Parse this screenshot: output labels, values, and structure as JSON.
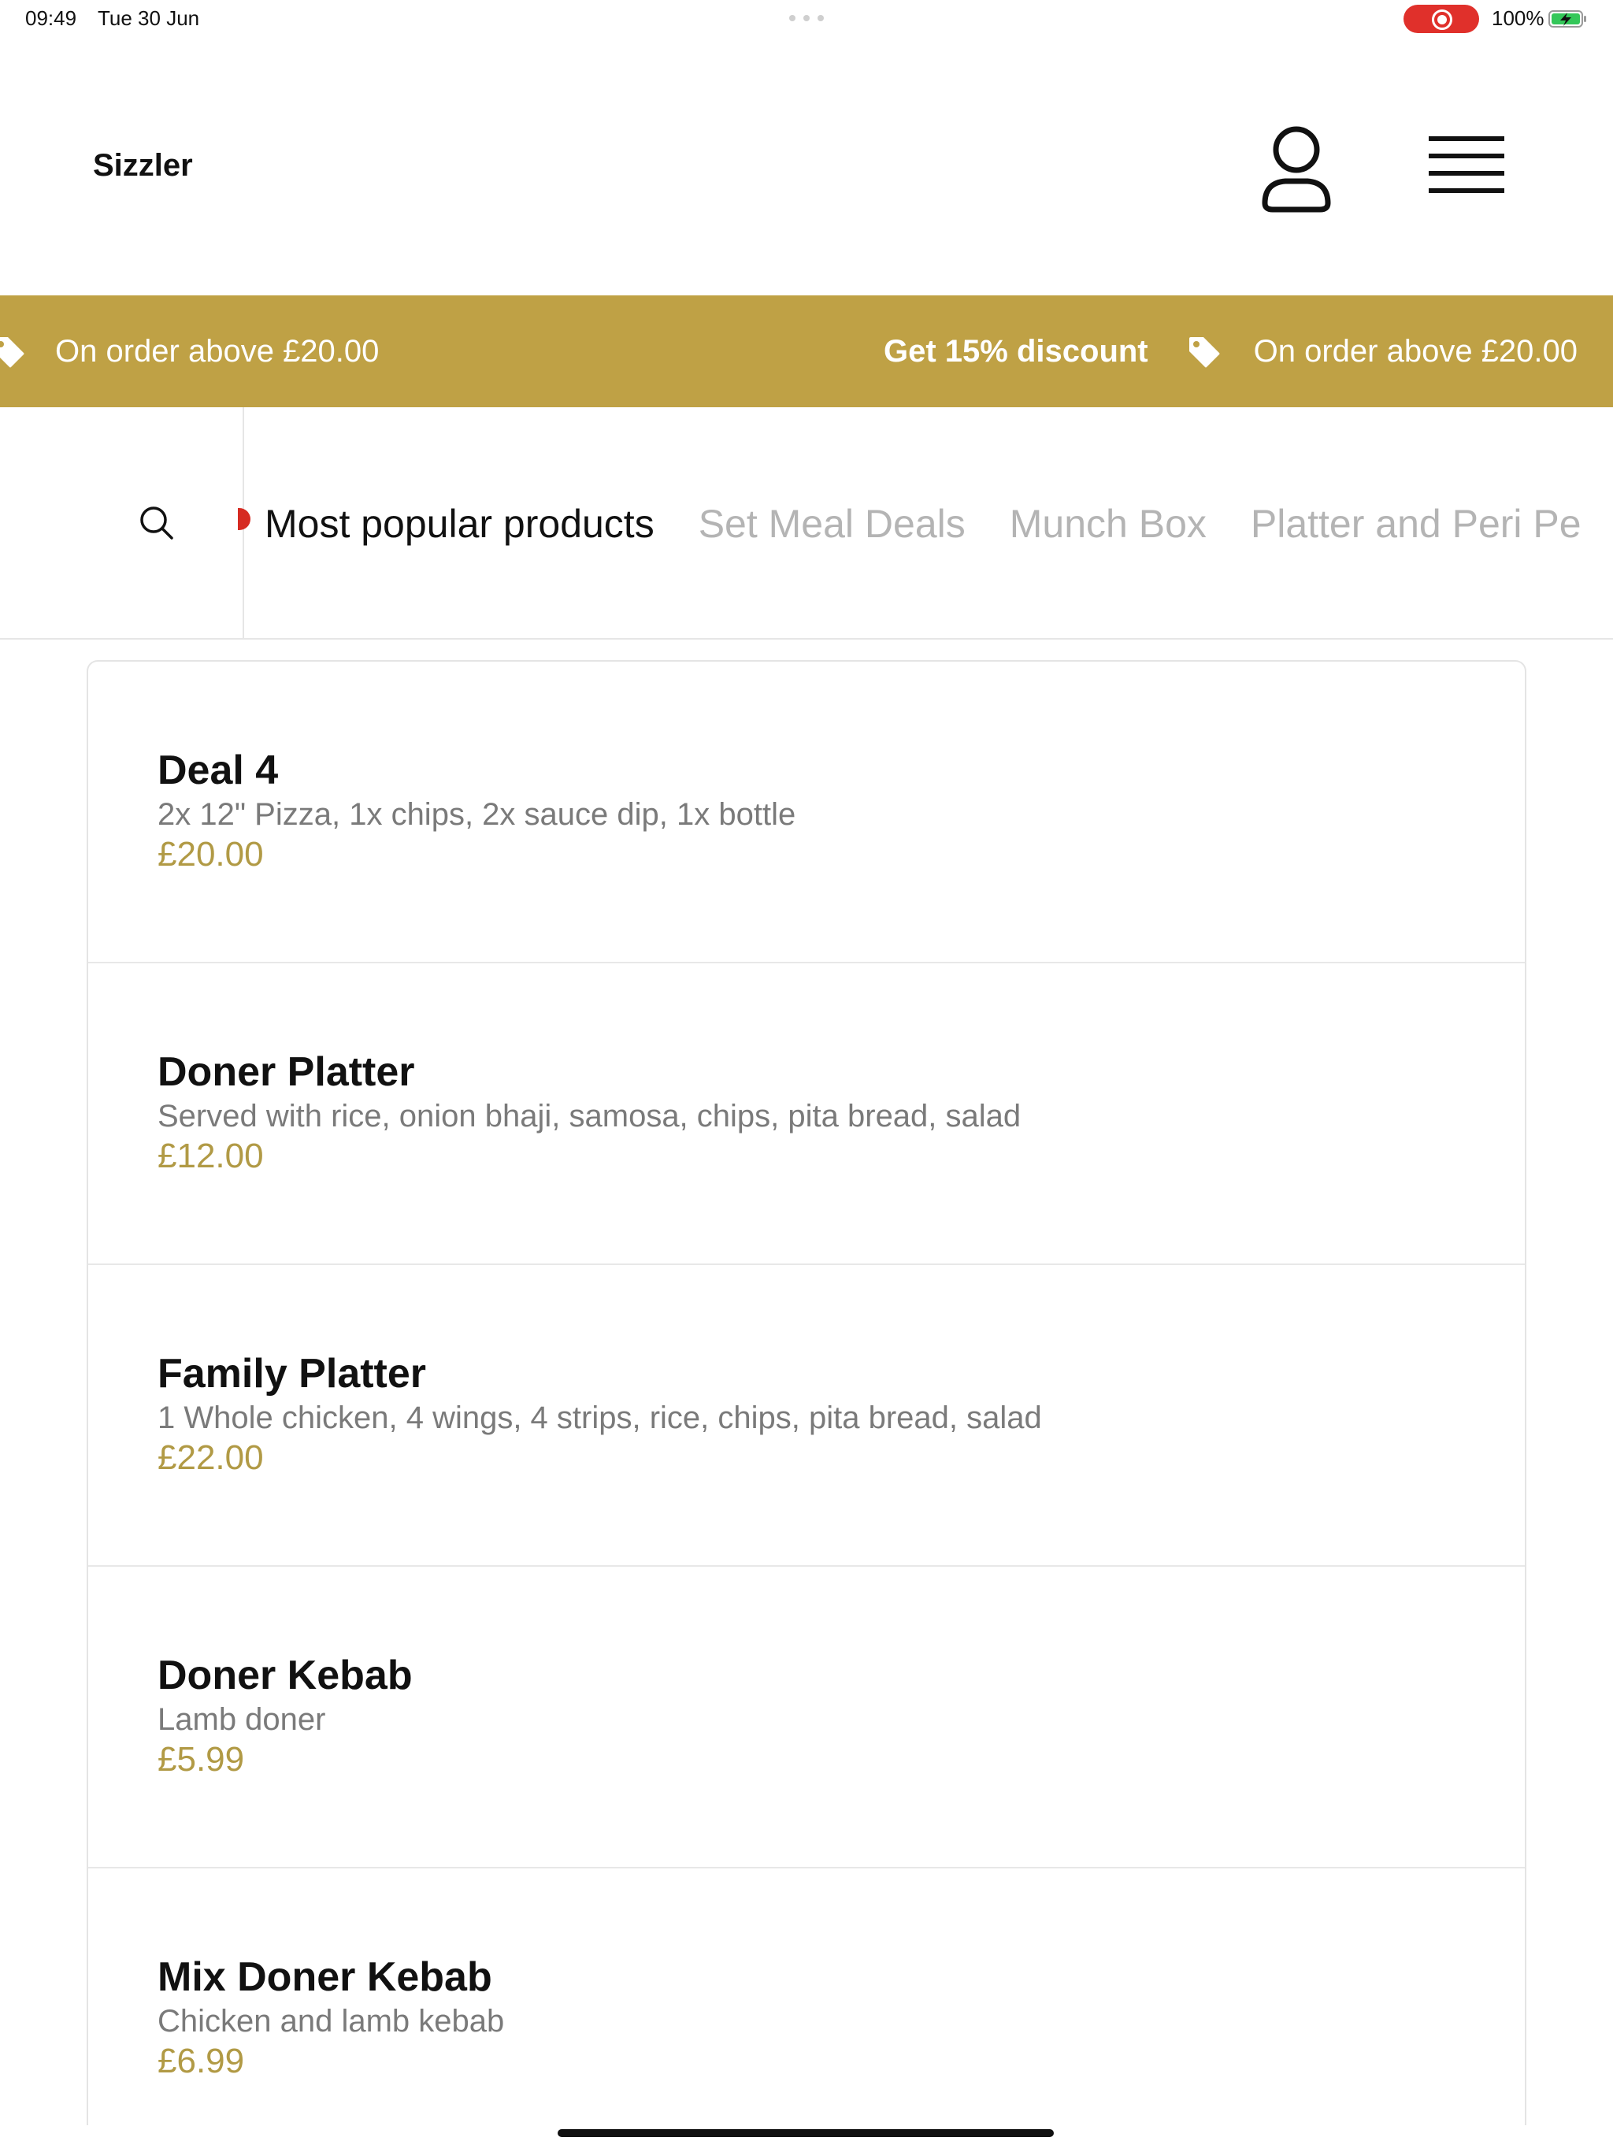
{
  "status_bar": {
    "time": "09:49",
    "date": "Tue 30 Jun",
    "battery": "100%"
  },
  "header": {
    "brand": "Sizzler",
    "account_icon": "person-outline-icon",
    "menu_icon": "hamburger-menu-icon"
  },
  "promo": {
    "left_text": "On order above £20.00",
    "middle_text": "Get 15% discount",
    "right_text": "On order above £20.00",
    "tag_icon": "price-tag-icon",
    "color": "#bfa145"
  },
  "categories": {
    "search_icon": "search-icon",
    "tabs": [
      {
        "label": "Most popular products",
        "active": true
      },
      {
        "label": "Set Meal Deals",
        "active": false
      },
      {
        "label": "Munch Box",
        "active": false
      },
      {
        "label": "Platter and Peri Pe",
        "active": false
      }
    ]
  },
  "products": [
    {
      "name": "Deal 4",
      "description": "2x 12\" Pizza, 1x chips, 2x sauce dip, 1x bottle",
      "price": "£20.00"
    },
    {
      "name": "Doner Platter",
      "description": "Served with rice, onion bhaji, samosa, chips, pita bread, salad",
      "price": "£12.00"
    },
    {
      "name": "Family Platter",
      "description": "1 Whole chicken, 4 wings, 4 strips, rice, chips, pita bread, salad",
      "price": "£22.00"
    },
    {
      "name": "Doner Kebab",
      "description": "Lamb doner",
      "price": "£5.99"
    },
    {
      "name": "Mix Doner Kebab",
      "description": "Chicken and lamb kebab",
      "price": "£6.99"
    }
  ],
  "colors": {
    "accent_gold": "#bfa145",
    "price_gold": "#b19a45",
    "record_red": "#e0302b"
  }
}
